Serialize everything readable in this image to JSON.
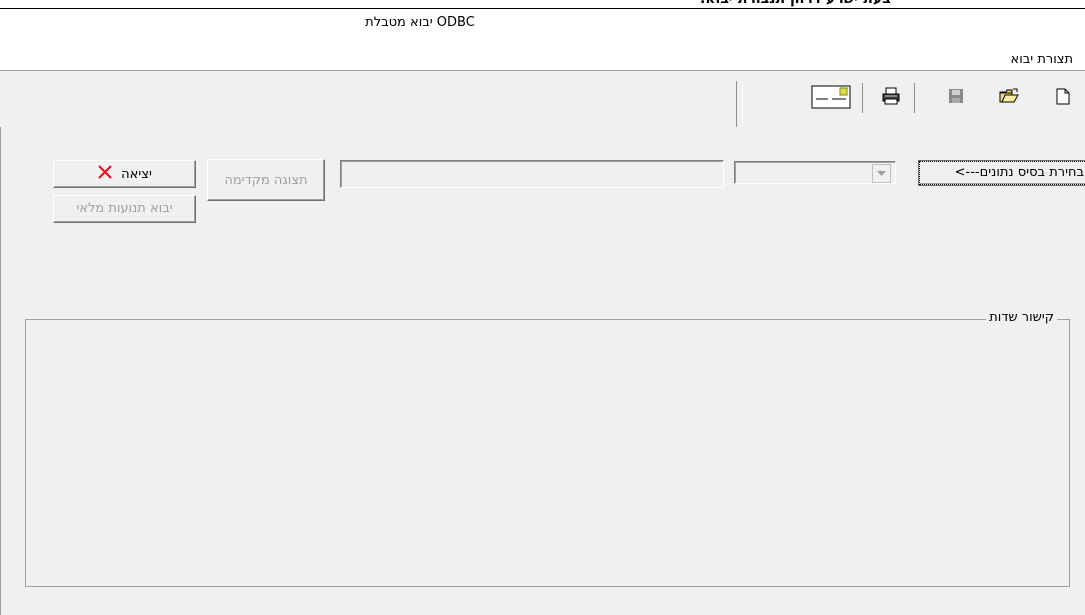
{
  "document": {
    "text_fragment": "בעת ישרע דרחן תנבורת יבוא."
  },
  "window": {
    "title": "יבוא מטבלת ODBC"
  },
  "menu": {
    "item": "תצורת יבוא"
  },
  "toolbar": {
    "icons": [
      "new-document-icon",
      "open-folder-icon",
      "save-icon",
      "print-icon",
      "envelope-icon"
    ]
  },
  "form": {
    "select_db_label": "בחירת בסיס נתונים--->",
    "preview_label": "תצוגה מקדימה",
    "exit_label": "יציאה",
    "import_full_label": "יבוא תנועות מלאי",
    "group_label": "קישור שדות"
  },
  "colors": {
    "face": "#f0f0f0",
    "exit_x": "#e81123",
    "disabled_text": "#a0a0a0"
  }
}
